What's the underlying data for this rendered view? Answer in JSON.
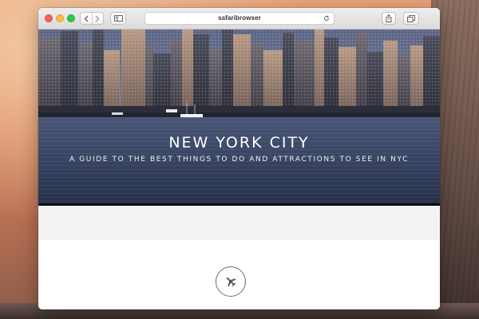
{
  "browser": {
    "address_text": "safaribrowser",
    "icons": {
      "back": "chevron-left-icon",
      "forward": "chevron-right-icon",
      "sidebar": "sidebar-icon",
      "reload": "reload-icon",
      "share": "share-icon",
      "tabs": "tabs-overview-icon"
    }
  },
  "hero": {
    "title": "NEW YORK CITY",
    "subtitle": "A GUIDE TO THE BEST THINGS TO DO AND ATTRACTIONS TO SEE IN NYC"
  },
  "feature": {
    "icon": "airplane-icon"
  }
}
